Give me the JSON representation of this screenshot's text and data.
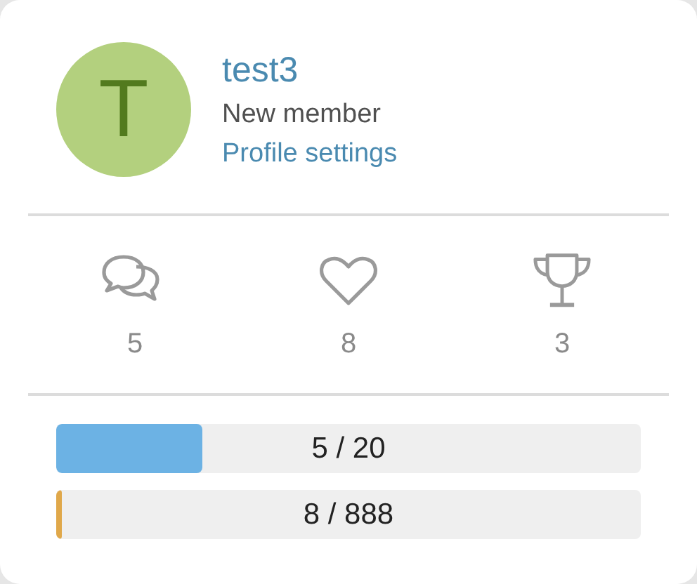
{
  "profile": {
    "avatar_letter": "T",
    "username": "test3",
    "title": "New member",
    "settings_link": "Profile settings"
  },
  "stats": [
    {
      "kind": "messages",
      "value": "5"
    },
    {
      "kind": "likes",
      "value": "8"
    },
    {
      "kind": "trophies",
      "value": "3"
    }
  ],
  "progress": [
    {
      "label": "5 / 20",
      "level": 0.25,
      "color": "#6cb2e4"
    },
    {
      "label": "8 / 888",
      "level": 0.009,
      "color": "#e0a84a"
    }
  ]
}
